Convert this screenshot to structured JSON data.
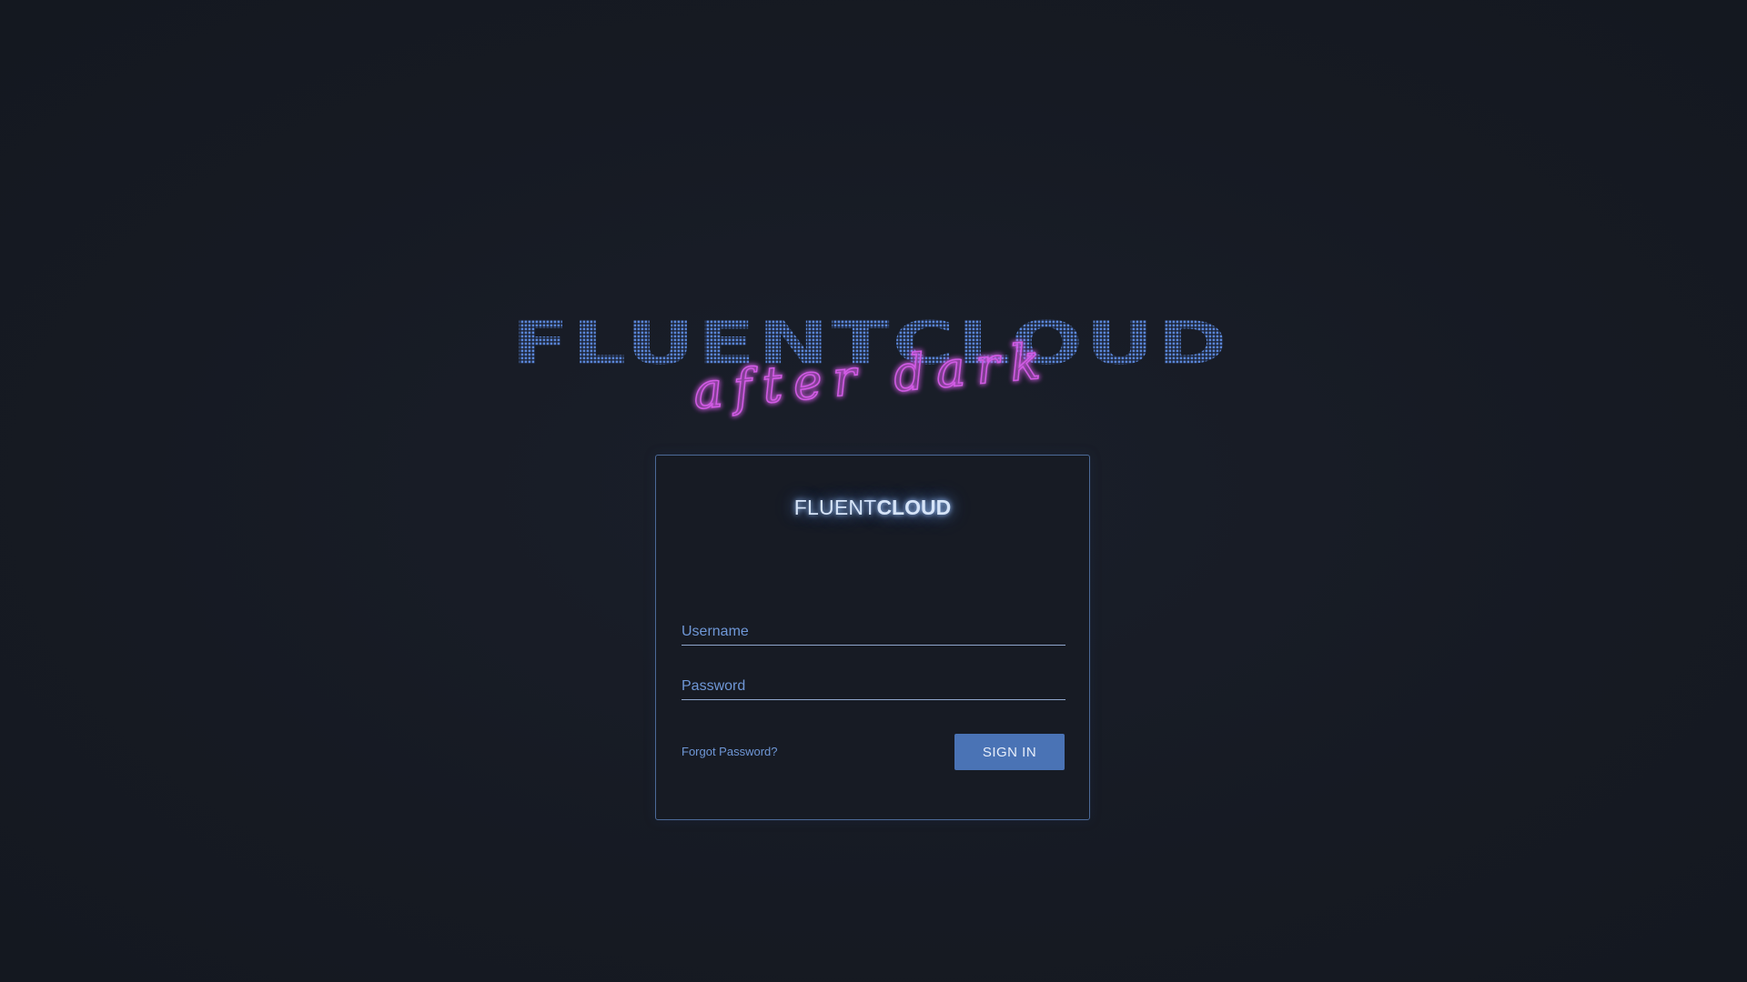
{
  "hero": {
    "wordmark": "FLUENTCLOUD",
    "script": "after dark",
    "wordmark_color": "#4f78c8",
    "script_color": "#d04ee0"
  },
  "card": {
    "logo_light": "FLUENT",
    "logo_bold": "CLOUD",
    "username_placeholder": "Username",
    "password_placeholder": "Password",
    "forgot_label": "Forgot Password?",
    "signin_label": "SIGN IN"
  },
  "colors": {
    "background": "#171b24",
    "card_border": "#4c6a98",
    "accent": "#4a73b5",
    "link": "#6f97d6"
  }
}
